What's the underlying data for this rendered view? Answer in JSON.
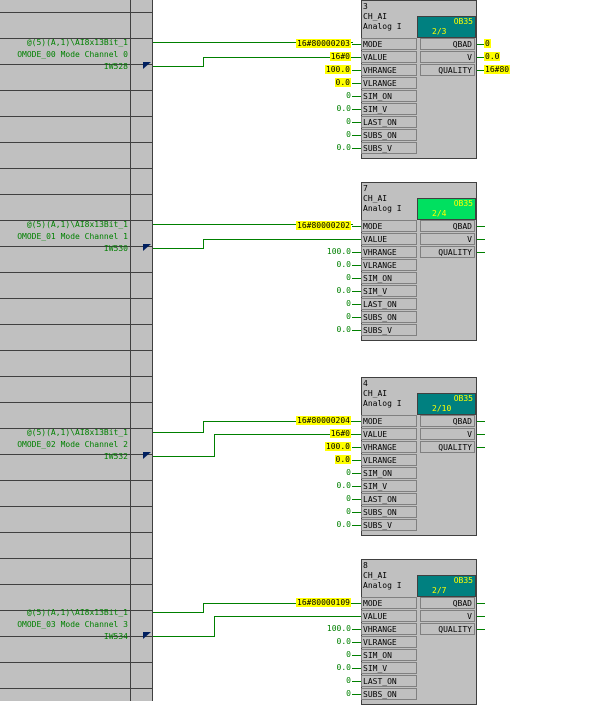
{
  "rows_left": [
    {
      "addr": "@(5)(A,1)\\AI8x13Bit_1",
      "comment": "OMODE_00 Mode Channel 0",
      "io": "IW528"
    },
    {
      "addr": "@(5)(A,1)\\AI8x13Bit_1",
      "comment": "OMODE_01 Mode Channel 1",
      "io": "IW530"
    },
    {
      "addr": "@(5)(A,1)\\AI8x13Bit_1",
      "comment": "OMODE_02 Mode Channel 2",
      "io": "IW532"
    },
    {
      "addr": "@(5)(A,1)\\AI8x13Bit_1",
      "comment": "OMODE_03 Mode Channel 3",
      "io": "IW534"
    }
  ],
  "blocks": [
    {
      "num": "3",
      "type": "CH_AI",
      "desc": "Analog I",
      "ob_label": "OB35",
      "ob_val": "2/3",
      "ob_color": "#008080",
      "inputs": [
        {
          "name": "MODE",
          "value": "16#80000203",
          "hl": true
        },
        {
          "name": "VALUE",
          "value": "16#0",
          "hl": true
        },
        {
          "name": "VHRANGE",
          "value": "100.0",
          "hl": true
        },
        {
          "name": "VLRANGE",
          "value": "0.0",
          "hl": true
        },
        {
          "name": "SIM_ON",
          "value": "0",
          "hl": false
        },
        {
          "name": "SIM_V",
          "value": "0.0",
          "hl": false
        },
        {
          "name": "LAST_ON",
          "value": "0",
          "hl": false
        },
        {
          "name": "SUBS_ON",
          "value": "0",
          "hl": false
        },
        {
          "name": "SUBS_V",
          "value": "0.0",
          "hl": false
        }
      ],
      "outputs": [
        {
          "name": "QBAD",
          "value": "0"
        },
        {
          "name": "V",
          "value": "0.0"
        },
        {
          "name": "QUALITY",
          "value": "16#80"
        }
      ]
    },
    {
      "num": "7",
      "type": "CH_AI",
      "desc": "Analog I",
      "ob_label": "OB35",
      "ob_val": "2/4",
      "ob_color": "#00e060",
      "inputs": [
        {
          "name": "MODE",
          "value": "16#80000202",
          "hl": true
        },
        {
          "name": "VALUE",
          "value": "",
          "hl": false
        },
        {
          "name": "VHRANGE",
          "value": "100.0",
          "hl": false
        },
        {
          "name": "VLRANGE",
          "value": "0.0",
          "hl": false
        },
        {
          "name": "SIM_ON",
          "value": "0",
          "hl": false
        },
        {
          "name": "SIM_V",
          "value": "0.0",
          "hl": false
        },
        {
          "name": "LAST_ON",
          "value": "0",
          "hl": false
        },
        {
          "name": "SUBS_ON",
          "value": "0",
          "hl": false
        },
        {
          "name": "SUBS_V",
          "value": "0.0",
          "hl": false
        }
      ],
      "outputs": [
        {
          "name": "QBAD",
          "value": ""
        },
        {
          "name": "V",
          "value": ""
        },
        {
          "name": "QUALITY",
          "value": ""
        }
      ]
    },
    {
      "num": "4",
      "type": "CH_AI",
      "desc": "Analog I",
      "ob_label": "OB35",
      "ob_val": "2/10",
      "ob_color": "#008080",
      "inputs": [
        {
          "name": "MODE",
          "value": "16#80000204",
          "hl": true
        },
        {
          "name": "VALUE",
          "value": "16#0",
          "hl": true
        },
        {
          "name": "VHRANGE",
          "value": "100.0",
          "hl": true
        },
        {
          "name": "VLRANGE",
          "value": "0.0",
          "hl": true
        },
        {
          "name": "SIM_ON",
          "value": "0",
          "hl": false
        },
        {
          "name": "SIM_V",
          "value": "0.0",
          "hl": false
        },
        {
          "name": "LAST_ON",
          "value": "0",
          "hl": false
        },
        {
          "name": "SUBS_ON",
          "value": "0",
          "hl": false
        },
        {
          "name": "SUBS_V",
          "value": "0.0",
          "hl": false
        }
      ],
      "outputs": [
        {
          "name": "QBAD",
          "value": ""
        },
        {
          "name": "V",
          "value": ""
        },
        {
          "name": "QUALITY",
          "value": ""
        }
      ]
    },
    {
      "num": "8",
      "type": "CH_AI",
      "desc": "Analog I",
      "ob_label": "OB35",
      "ob_val": "2/7",
      "ob_color": "#008080",
      "inputs": [
        {
          "name": "MODE",
          "value": "16#80000109",
          "hl": true
        },
        {
          "name": "VALUE",
          "value": "",
          "hl": false
        },
        {
          "name": "VHRANGE",
          "value": "100.0",
          "hl": false
        },
        {
          "name": "VLRANGE",
          "value": "0.0",
          "hl": false
        },
        {
          "name": "SIM_ON",
          "value": "0",
          "hl": false
        },
        {
          "name": "SIM_V",
          "value": "0.0",
          "hl": false
        },
        {
          "name": "LAST_ON",
          "value": "0",
          "hl": false
        },
        {
          "name": "SUBS_ON",
          "value": "0",
          "hl": false
        }
      ],
      "outputs": [
        {
          "name": "QBAD",
          "value": ""
        },
        {
          "name": "V",
          "value": ""
        },
        {
          "name": "QUALITY",
          "value": ""
        }
      ]
    }
  ]
}
